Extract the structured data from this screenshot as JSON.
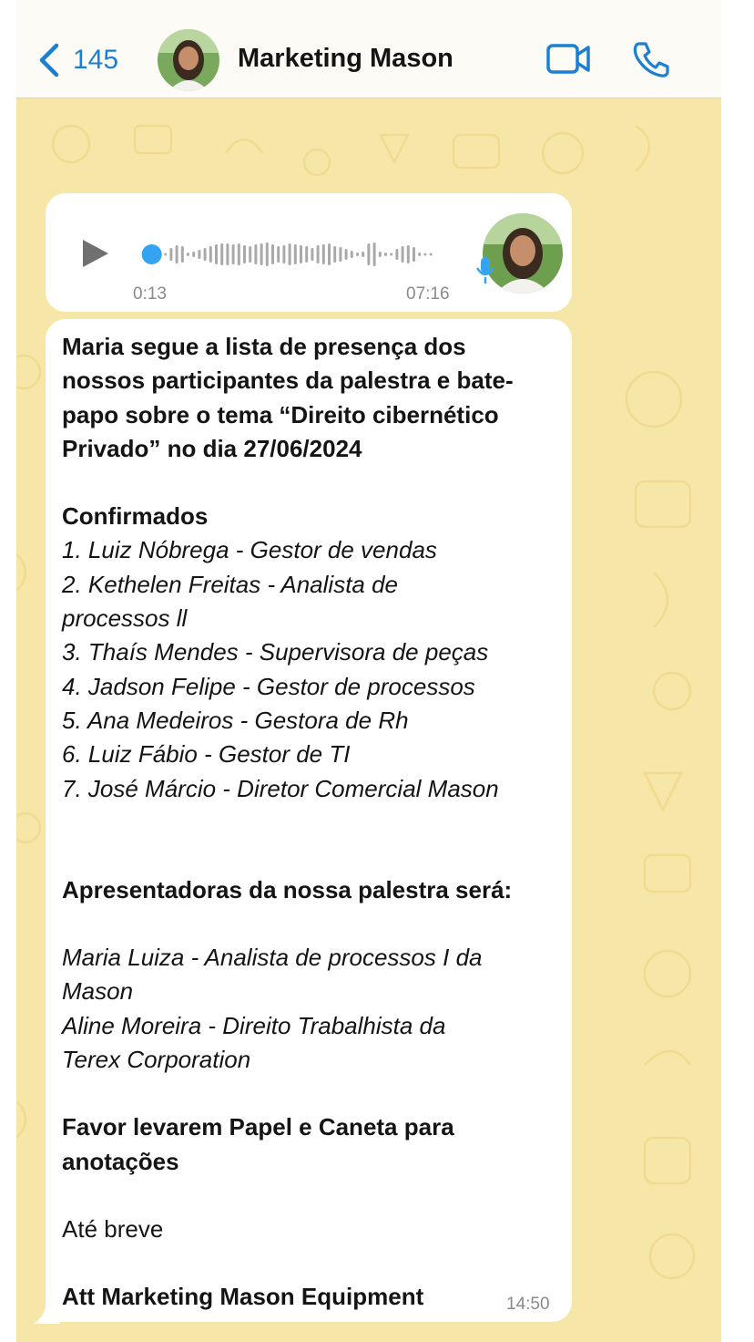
{
  "header": {
    "back_count": "145",
    "contact_name": "Marketing Mason"
  },
  "voice_message": {
    "elapsed": "0:13",
    "duration": "07:16",
    "playback_progress": 0.03
  },
  "message": {
    "intro": [
      "Maria segue a lista de presença dos",
      "nossos participantes da palestra e bate-",
      "papo sobre o tema “Direito cibernético",
      "Privado” no dia 27/06/2024"
    ],
    "confirmed_heading": "Confirmados",
    "confirmed": [
      "1. Luiz Nóbrega - Gestor de vendas",
      "2. Kethelen Freitas - Analista de",
      "processos ll",
      "3. Thaís Mendes - Supervisora de peças",
      "4. Jadson Felipe - Gestor de processos",
      "5. Ana Medeiros - Gestora de Rh",
      "6. Luiz Fábio - Gestor de TI",
      "7. José Márcio - Diretor Comercial Mason"
    ],
    "presenters_heading": "Apresentadoras da nossa palestra será:",
    "presenters": [
      "Maria Luiza - Analista de processos I da",
      "Mason",
      "Aline Moreira - Direito Trabalhista da",
      "Terex Corporation"
    ],
    "request": [
      "Favor levarem Papel e Caneta para",
      "anotações"
    ],
    "closing": "Até breve",
    "signature": "Att Marketing Mason Equipment",
    "time": "14:50"
  },
  "colors": {
    "accent": "#1b7fd3",
    "wallpaper": "#f6e7a9",
    "bubble": "#ffffff",
    "header_bg": "#fdfbf5"
  }
}
